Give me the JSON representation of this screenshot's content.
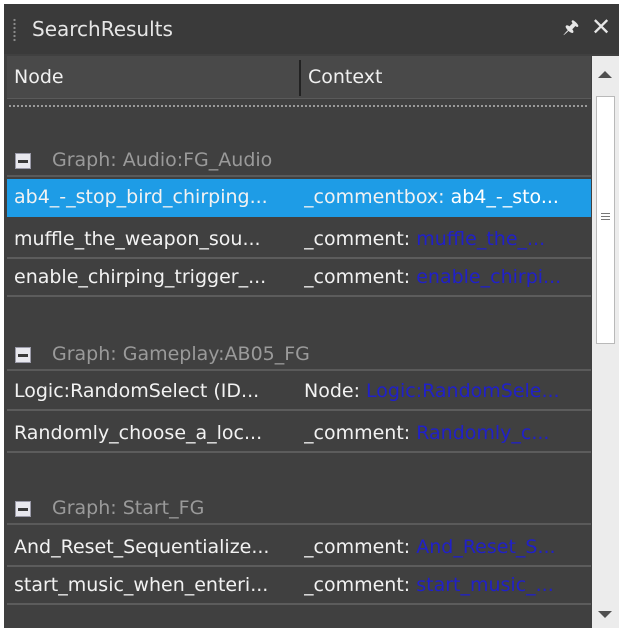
{
  "panel": {
    "title": "SearchResults",
    "pin_icon": "pin-icon",
    "close_icon": "close-icon"
  },
  "columns": {
    "node": "Node",
    "context": "Context"
  },
  "groups": [
    {
      "label": "Graph: Audio:FG_Audio",
      "rows": [
        {
          "node": "ab4_-_stop_bird_chirping...",
          "ctx_prefix": "_commentbox: ",
          "ctx_match": "ab4_-_sto...",
          "selected": true
        },
        {
          "node": "muffle_the_weapon_sou...",
          "ctx_prefix": "_comment: ",
          "ctx_match": "muffle_the_...",
          "selected": false
        },
        {
          "node": "enable_chirping_trigger_...",
          "ctx_prefix": "_comment: ",
          "ctx_match": "enable_chirpi...",
          "selected": false
        }
      ]
    },
    {
      "label": "Graph: Gameplay:AB05_FG",
      "rows": [
        {
          "node": "Logic:RandomSelect  (ID...",
          "ctx_prefix": "Node: ",
          "ctx_match": "Logic:RandomSele...",
          "selected": false
        },
        {
          "node": "Randomly_choose_a_loc...",
          "ctx_prefix": "_comment: ",
          "ctx_match": "Randomly_c...",
          "selected": false
        }
      ]
    },
    {
      "label": "Graph: Start_FG",
      "rows": [
        {
          "node": "And_Reset_Sequentialize...",
          "ctx_prefix": "_comment: ",
          "ctx_match": "And_Reset_S...",
          "selected": false
        },
        {
          "node": "start_music_when_enteri...",
          "ctx_prefix": "_comment: ",
          "ctx_match": "start_music_...",
          "selected": false
        }
      ]
    }
  ],
  "colors": {
    "selection": "#1e9ce6",
    "match_highlight": "#2020c8",
    "background": "#404040"
  }
}
